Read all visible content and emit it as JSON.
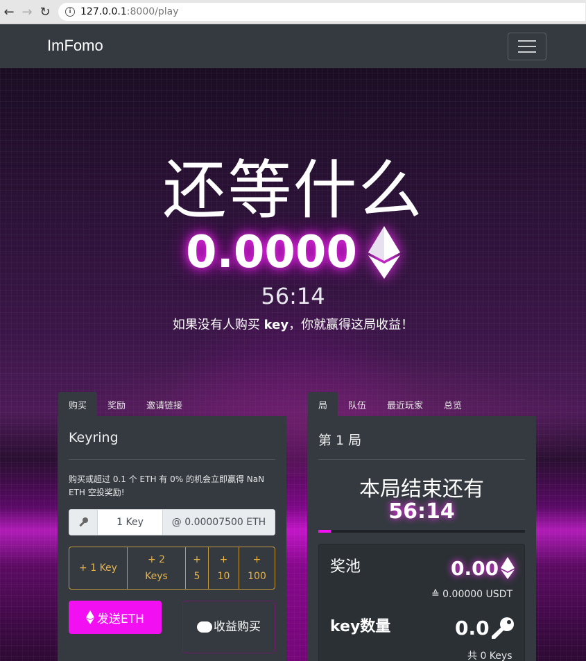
{
  "browser": {
    "url_host": "127.0.0.1",
    "url_path": ":8000/play"
  },
  "navbar": {
    "brand": "ImFomo"
  },
  "hero": {
    "headline": "还等什么",
    "pot_value": "0.0000",
    "timer": "56:14",
    "subline_before": "如果没有人购买 ",
    "subline_bold": "key",
    "subline_after": "，你就赢得这局收益！"
  },
  "left_panel": {
    "tabs": [
      "购买",
      "奖励",
      "邀请链接"
    ],
    "title": "Keyring",
    "description": "购买或超过 0.1 个 ETH 有 0% 的机会立即赢得 NaN ETH 空投奖励!",
    "key_input_value": "1 Key",
    "price_suffix": "@ 0.00007500 ETH",
    "quick_buttons": [
      "+ 1 Key",
      "+ 2 Keys",
      "+ 5",
      "+ 10",
      "+ 100"
    ],
    "send_button": "发送ETH",
    "reinvest_button": "收益购买"
  },
  "right_panel": {
    "tabs": [
      "局",
      "队伍",
      "最近玩家",
      "总览"
    ],
    "round_title": "第 1 局",
    "ends_in_label": "本局结束还有",
    "ends_in_timer": "56:14",
    "progress_fraction": 0.06,
    "pot_label": "奖池",
    "pot_value": "0.00",
    "pot_usdt": "≙ 0.00000 USDT",
    "keys_label": "key数量",
    "keys_value": "0.0",
    "keys_total": "共 0 Keys"
  },
  "colors": {
    "accent": "#f20ff2",
    "gold": "#c59a3c",
    "panel": "#343a40"
  }
}
